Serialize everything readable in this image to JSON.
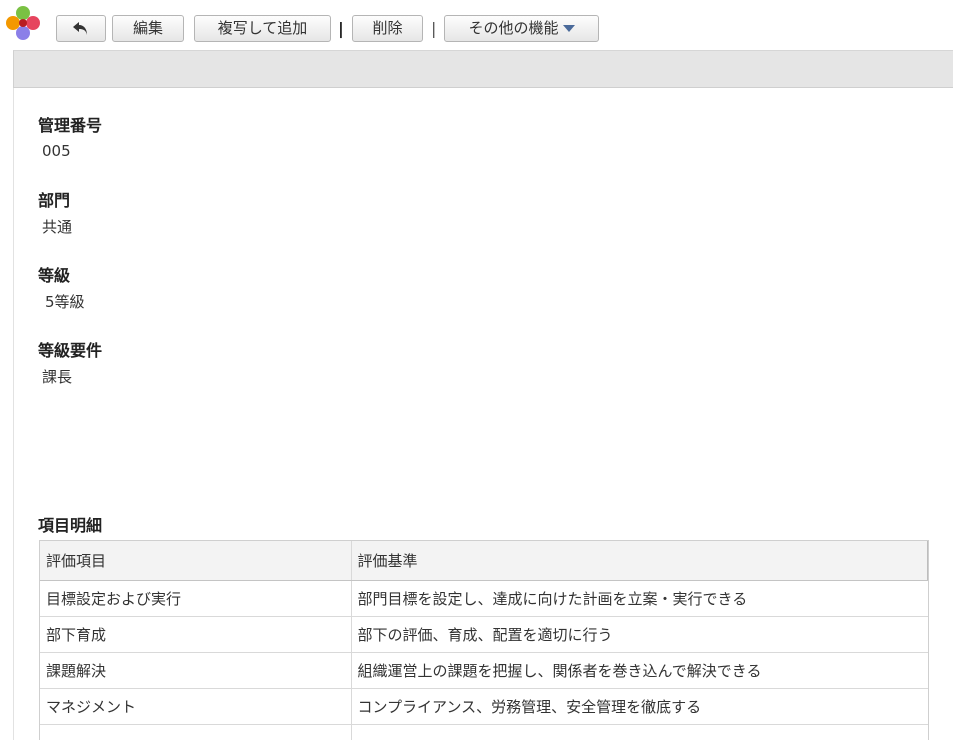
{
  "toolbar": {
    "back_label": "",
    "edit_label": "編集",
    "copy_add_label": "複写して追加",
    "separator1": "|",
    "delete_label": "削除",
    "separator2": "|",
    "more_label": "その他の機能"
  },
  "fields": {
    "control_number": {
      "label": "管理番号",
      "value": "005"
    },
    "department": {
      "label": "部門",
      "value": "共通"
    },
    "grade": {
      "label": "等級",
      "value": "5等級"
    },
    "grade_requirement": {
      "label": "等級要件",
      "value": "課長"
    }
  },
  "details": {
    "title": "項目明細",
    "columns": [
      "評価項目",
      "評価基準"
    ],
    "rows": [
      {
        "item": "目標設定および実行",
        "criteria": "部門目標を設定し、達成に向けた計画を立案・実行できる"
      },
      {
        "item": "部下育成",
        "criteria": "部下の評価、育成、配置を適切に行う"
      },
      {
        "item": "課題解決",
        "criteria": "組織運営上の課題を把握し、関係者を巻き込んで解決できる"
      },
      {
        "item": "マネジメント",
        "criteria": "コンプライアンス、労務管理、安全管理を徹底する"
      }
    ]
  },
  "colors": {
    "logo_green": "#7ac143",
    "logo_orange": "#f39800",
    "logo_red": "#e6455e",
    "logo_purple": "#8b7fe8",
    "caret_blue": "#4a6a9a"
  }
}
